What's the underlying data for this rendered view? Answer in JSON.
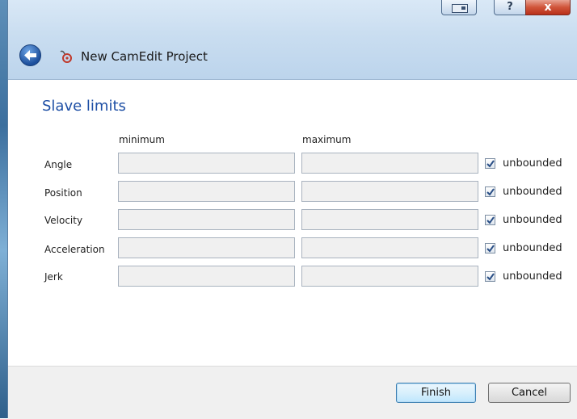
{
  "window": {
    "title": "New CamEdit Project",
    "buttons": {
      "compact": "compact-mode-icon",
      "help": "?",
      "close": "x"
    }
  },
  "page": {
    "heading": "Slave limits",
    "columns": {
      "minimum": "minimum",
      "maximum": "maximum"
    },
    "rows": [
      {
        "label": "Angle",
        "minimum": "",
        "maximum": "",
        "unbounded_label": "unbounded",
        "unbounded": true
      },
      {
        "label": "Position",
        "minimum": "",
        "maximum": "",
        "unbounded_label": "unbounded",
        "unbounded": true
      },
      {
        "label": "Velocity",
        "minimum": "",
        "maximum": "",
        "unbounded_label": "unbounded",
        "unbounded": true
      },
      {
        "label": "Acceleration",
        "minimum": "",
        "maximum": "",
        "unbounded_label": "unbounded",
        "unbounded": true
      },
      {
        "label": "Jerk",
        "minimum": "",
        "maximum": "",
        "unbounded_label": "unbounded",
        "unbounded": true
      }
    ]
  },
  "footer": {
    "finish_label": "Finish",
    "cancel_label": "Cancel"
  },
  "colors": {
    "heading": "#1e4fa5",
    "accent": "#3c7fb1",
    "close": "#c0392b"
  }
}
